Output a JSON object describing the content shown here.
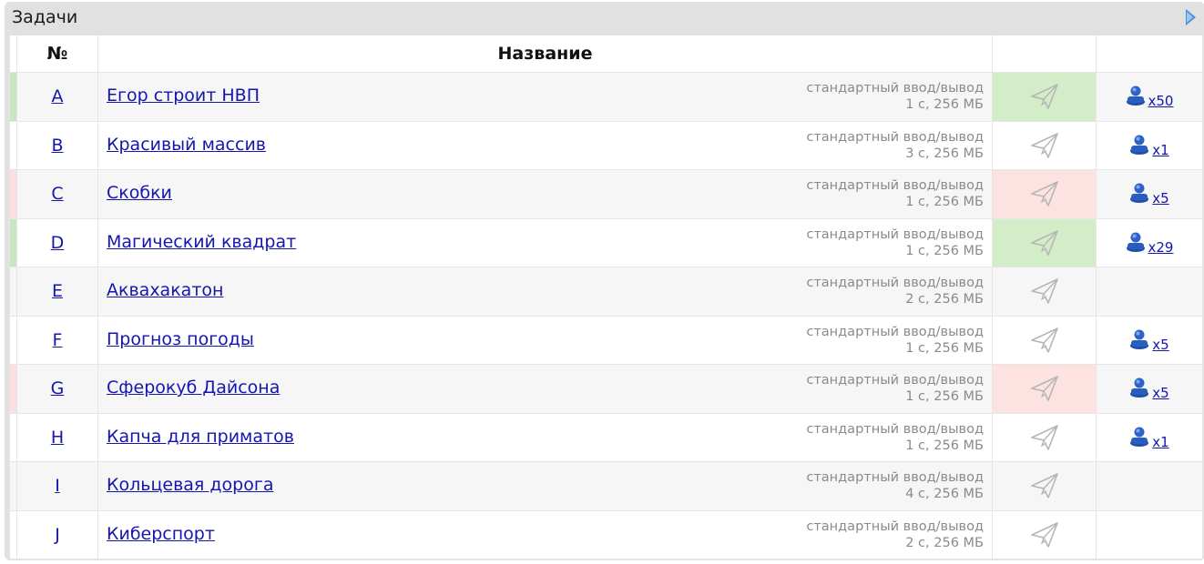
{
  "panel": {
    "title": "Задачи"
  },
  "table": {
    "columns": {
      "number": "№",
      "name": "Название"
    },
    "rows": [
      {
        "id": "A",
        "name": "Егор строит НВП",
        "io": "стандартный ввод/вывод",
        "limits": "1 с, 256 МБ",
        "status": "ok",
        "solved": "x50"
      },
      {
        "id": "B",
        "name": "Красивый массив",
        "io": "стандартный ввод/вывод",
        "limits": "3 с, 256 МБ",
        "status": "none",
        "solved": "x1"
      },
      {
        "id": "C",
        "name": "Скобки",
        "io": "стандартный ввод/вывод",
        "limits": "1 с, 256 МБ",
        "status": "fail",
        "solved": "x5"
      },
      {
        "id": "D",
        "name": "Магический квадрат",
        "io": "стандартный ввод/вывод",
        "limits": "1 с, 256 МБ",
        "status": "ok",
        "solved": "x29"
      },
      {
        "id": "E",
        "name": "Аквахакатон",
        "io": "стандартный ввод/вывод",
        "limits": "2 с, 256 МБ",
        "status": "none",
        "solved": ""
      },
      {
        "id": "F",
        "name": "Прогноз погоды",
        "io": "стандартный ввод/вывод",
        "limits": "1 с, 256 МБ",
        "status": "none",
        "solved": "x5"
      },
      {
        "id": "G",
        "name": "Сферокуб Дайсона",
        "io": "стандартный ввод/вывод",
        "limits": "1 с, 256 МБ",
        "status": "fail",
        "solved": "x5"
      },
      {
        "id": "H",
        "name": "Капча для приматов",
        "io": "стандартный ввод/вывод",
        "limits": "1 с, 256 МБ",
        "status": "none",
        "solved": "x1"
      },
      {
        "id": "I",
        "name": "Кольцевая дорога",
        "io": "стандартный ввод/вывод",
        "limits": "4 с, 256 МБ",
        "status": "none",
        "solved": ""
      },
      {
        "id": "J",
        "name": "Киберспорт",
        "io": "стандартный ввод/вывод",
        "limits": "2 с, 256 МБ",
        "status": "none",
        "solved": ""
      }
    ]
  },
  "colors": {
    "ok": "#d3edc8",
    "fail": "#fde2e2",
    "link": "#1515b0",
    "accent": "#4a8fdc"
  },
  "icons": {
    "submit": "paper-plane-icon",
    "solved": "user-icon",
    "collapse": "collapse-arrow-icon"
  }
}
